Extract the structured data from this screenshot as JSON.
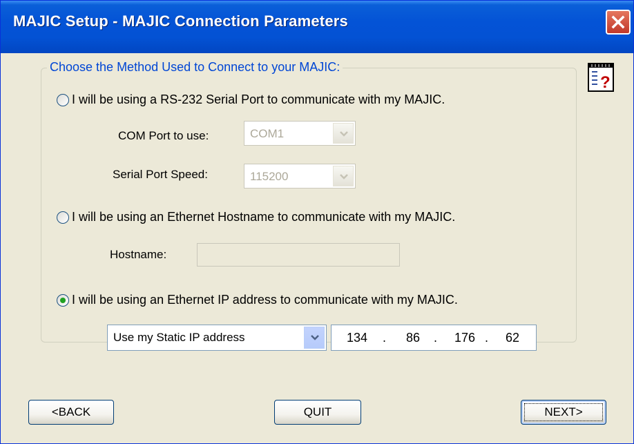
{
  "window": {
    "title": "MAJIC Setup - MAJIC Connection Parameters",
    "close_icon": "close-icon"
  },
  "group": {
    "legend": "Choose the Method Used to Connect to your MAJIC:"
  },
  "help_icon": "notepad-help-icon",
  "options": {
    "serial": {
      "label": "I will be using a RS-232 Serial Port to communicate with my MAJIC.",
      "checked": false,
      "com_port_label": "COM Port to use:",
      "com_port_value": "COM1",
      "speed_label": "Serial Port Speed:",
      "speed_value": "115200"
    },
    "hostname": {
      "label": "I will be using an Ethernet Hostname to communicate with my MAJIC.",
      "checked": false,
      "hostname_label": "Hostname:",
      "hostname_value": ""
    },
    "ip": {
      "label": "I will be using an Ethernet IP address to communicate with my MAJIC.",
      "checked": true,
      "mode_value": "Use my Static IP address",
      "octets": [
        "134",
        "86",
        "176",
        "62"
      ],
      "separator": "."
    }
  },
  "buttons": {
    "back": "<BACK",
    "quit": "QUIT",
    "next": "NEXT>"
  },
  "colors": {
    "title_bar": "#0453D6",
    "legend_text": "#0046D5",
    "radio_selected": "#21A121",
    "window_bg": "#ECE9D8"
  }
}
